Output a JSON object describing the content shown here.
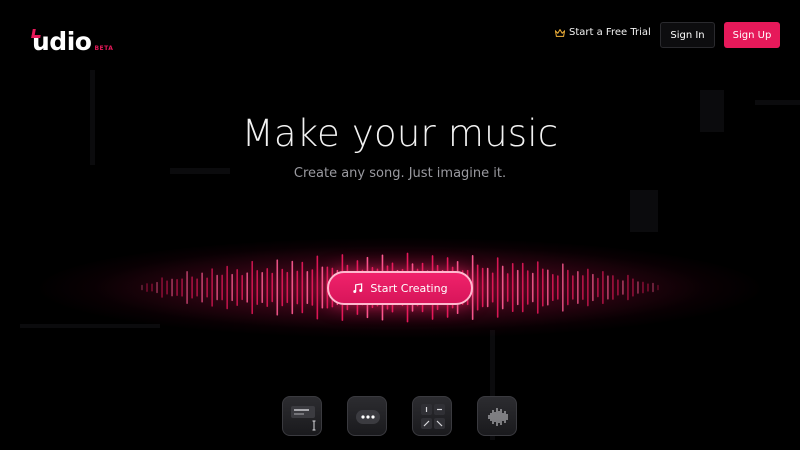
{
  "brand": {
    "name": "udio",
    "badge": "BETA",
    "accent": "#e6195a"
  },
  "header": {
    "trial_label": "Start a Free Trial",
    "signin_label": "Sign In",
    "signup_label": "Sign Up"
  },
  "hero": {
    "title": "Make your music",
    "subtitle": "Create any song. Just imagine it.",
    "cta_label": "Start Creating"
  },
  "icons": {
    "trial": "crown-icon",
    "cta": "music-note-icon",
    "tiles": [
      "text-prompt-icon",
      "more-options-icon",
      "controls-icon",
      "waveform-icon"
    ]
  }
}
